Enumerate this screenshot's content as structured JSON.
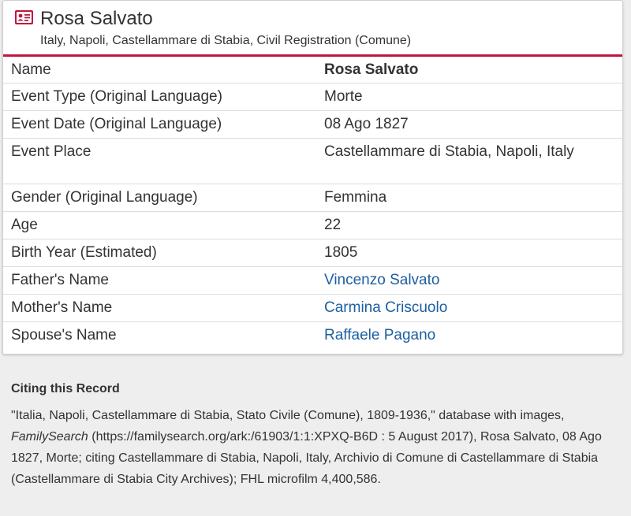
{
  "record": {
    "title": "Rosa Salvato",
    "subtitle": "Italy, Napoli, Castellammare di Stabia, Civil Registration (Comune)",
    "icon": "record-card-icon",
    "accent_color": "#c0163b",
    "link_color": "#1d5fa0",
    "rows": [
      {
        "label": "Name",
        "value": "Rosa Salvato"
      },
      {
        "label": "Event Type (Original Language)",
        "value": "Morte"
      },
      {
        "label": "Event Date (Original Language)",
        "value": "08 Ago 1827"
      },
      {
        "label": "Event Place",
        "value": "Castellammare di Stabia, Napoli, Italy"
      },
      {
        "label": "Gender (Original Language)",
        "value": "Femmina"
      },
      {
        "label": "Age",
        "value": "22"
      },
      {
        "label": "Birth Year (Estimated)",
        "value": "1805"
      },
      {
        "label": "Father's Name",
        "value": "Vincenzo Salvato"
      },
      {
        "label": "Mother's Name",
        "value": "Carmina Criscuolo"
      },
      {
        "label": "Spouse's Name",
        "value": "Raffaele Pagano"
      }
    ]
  },
  "citation": {
    "heading": "Citing this Record",
    "text_before": "\"Italia, Napoli, Castellammare di Stabia, Stato Civile (Comune), 1809-1936,\" database with images, ",
    "italic_source": "FamilySearch",
    "text_after": " (https://familysearch.org/ark:/61903/1:1:XPXQ-B6D : 5 August 2017), Rosa Salvato, 08 Ago 1827, Morte; citing Castellammare di Stabia, Napoli, Italy, Archivio di Comune di Castellammare di Stabia (Castellammare di Stabia City Archives); FHL microfilm 4,400,586."
  }
}
